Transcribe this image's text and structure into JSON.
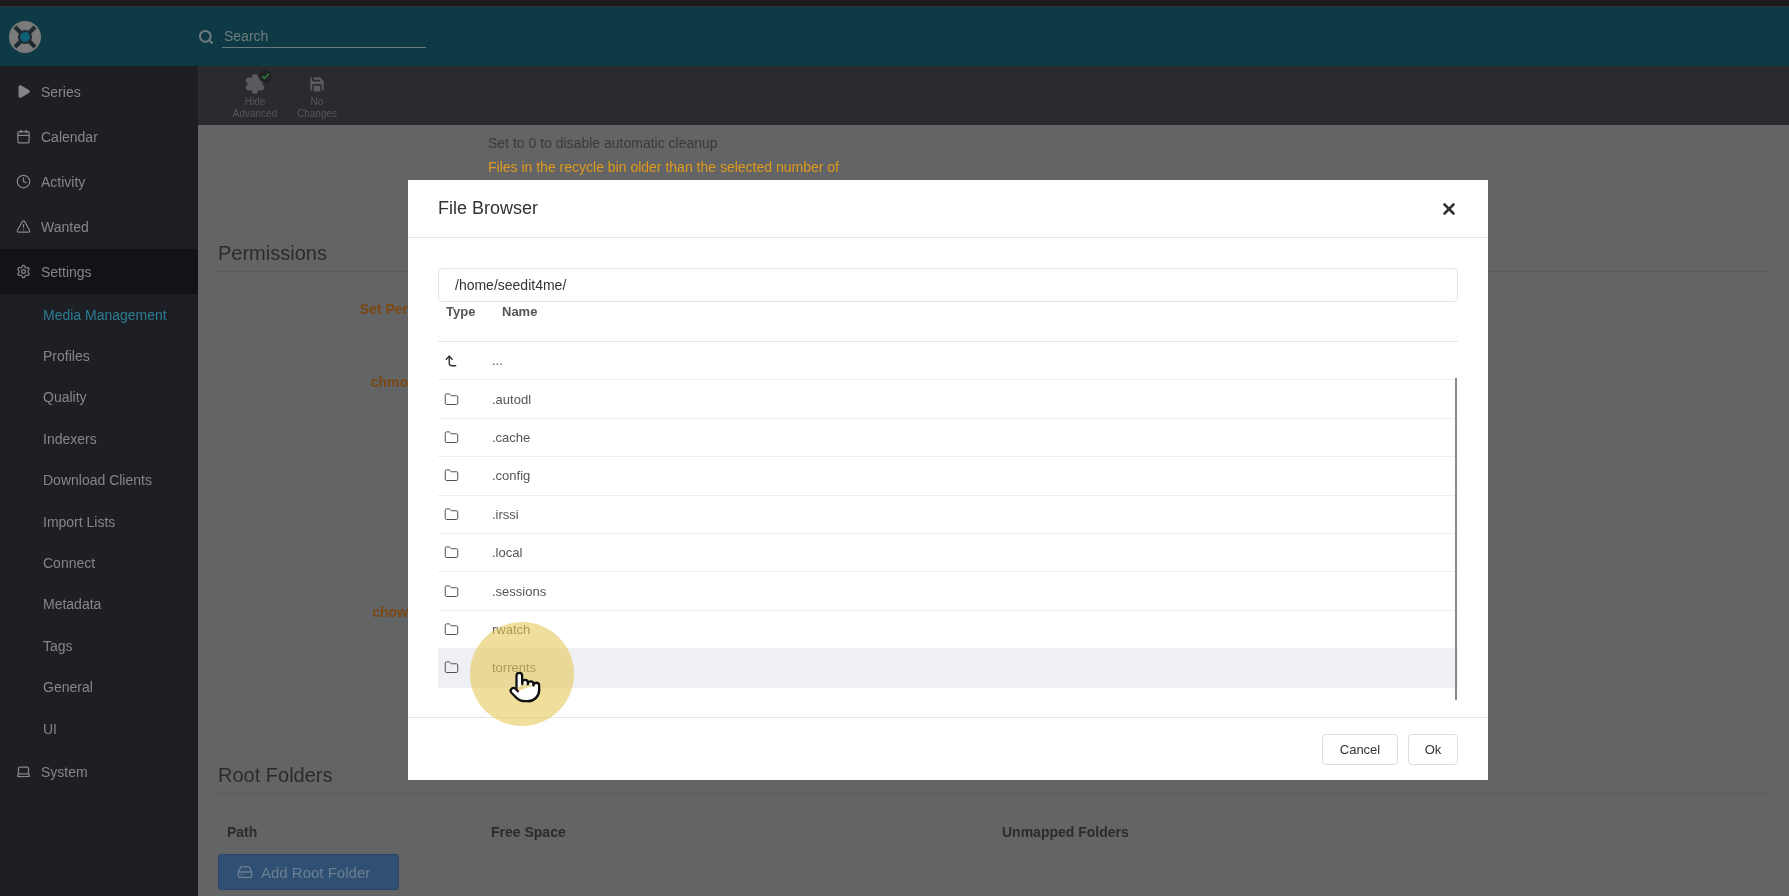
{
  "header": {
    "search": {
      "placeholder": "Search"
    }
  },
  "sidebar": {
    "items": [
      {
        "label": "Series",
        "active": false
      },
      {
        "label": "Calendar",
        "active": false
      },
      {
        "label": "Activity",
        "active": false
      },
      {
        "label": "Wanted",
        "active": false
      },
      {
        "label": "Settings",
        "active": true,
        "children": [
          {
            "label": "Media Management",
            "selected": true
          },
          {
            "label": "Profiles",
            "selected": false
          },
          {
            "label": "Quality",
            "selected": false
          },
          {
            "label": "Indexers",
            "selected": false
          },
          {
            "label": "Download Clients",
            "selected": false
          },
          {
            "label": "Import Lists",
            "selected": false
          },
          {
            "label": "Connect",
            "selected": false
          },
          {
            "label": "Metadata",
            "selected": false
          },
          {
            "label": "Tags",
            "selected": false
          },
          {
            "label": "General",
            "selected": false
          },
          {
            "label": "UI",
            "selected": false
          }
        ]
      },
      {
        "label": "System",
        "active": false
      }
    ]
  },
  "toolbar": {
    "buttons": [
      {
        "label": "Hide Advanced"
      },
      {
        "label": "No Changes"
      }
    ]
  },
  "content": {
    "cleanup_help": "Set to 0 to disable automatic cleanup",
    "recycle_warning": "Files in the recycle bin older than the selected number of",
    "permissions": {
      "title": "Permissions",
      "labels": [
        "Set Per",
        "chmo",
        "chow"
      ]
    },
    "root_folders": {
      "title": "Root Folders",
      "columns": [
        "Path",
        "Free Space",
        "Unmapped Folders"
      ],
      "add_button": "Add Root Folder"
    }
  },
  "modal": {
    "title": "File Browser",
    "path": "/home/seedit4me/",
    "columns": [
      "Type",
      "Name"
    ],
    "rows": [
      {
        "kind": "parent",
        "name": "...",
        "highlighted": false
      },
      {
        "kind": "folder",
        "name": ".autodl",
        "highlighted": false
      },
      {
        "kind": "folder",
        "name": ".cache",
        "highlighted": false
      },
      {
        "kind": "folder",
        "name": ".config",
        "highlighted": false
      },
      {
        "kind": "folder",
        "name": ".irssi",
        "highlighted": false
      },
      {
        "kind": "folder",
        "name": ".local",
        "highlighted": false
      },
      {
        "kind": "folder",
        "name": ".sessions",
        "highlighted": false
      },
      {
        "kind": "folder",
        "name": "rwatch",
        "highlighted": false
      },
      {
        "kind": "folder",
        "name": "torrents",
        "highlighted": true
      }
    ],
    "buttons": [
      "Cancel",
      "Ok"
    ]
  }
}
